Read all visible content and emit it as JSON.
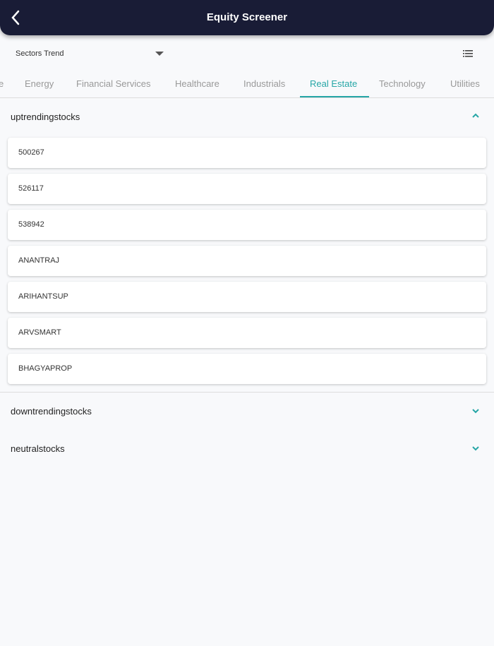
{
  "header": {
    "title": "Equity Screener"
  },
  "dropdown": {
    "selected": "Sectors Trend"
  },
  "tabs": [
    {
      "label": "e"
    },
    {
      "label": "Energy"
    },
    {
      "label": "Financial Services"
    },
    {
      "label": "Healthcare"
    },
    {
      "label": "Industrials"
    },
    {
      "label": "Real Estate"
    },
    {
      "label": "Technology"
    },
    {
      "label": "Utilities"
    }
  ],
  "active_tab": "Real Estate",
  "accent": "#26a6a6",
  "sections": {
    "up": {
      "label": "uptrendingstocks",
      "expanded": true,
      "items": [
        "500267",
        "526117",
        "538942",
        "ANANTRAJ",
        "ARIHANTSUP",
        "ARVSMART",
        "BHAGYAPROP"
      ]
    },
    "down": {
      "label": "downtrendingstocks",
      "expanded": false
    },
    "neutral": {
      "label": "neutralstocks",
      "expanded": false
    }
  }
}
